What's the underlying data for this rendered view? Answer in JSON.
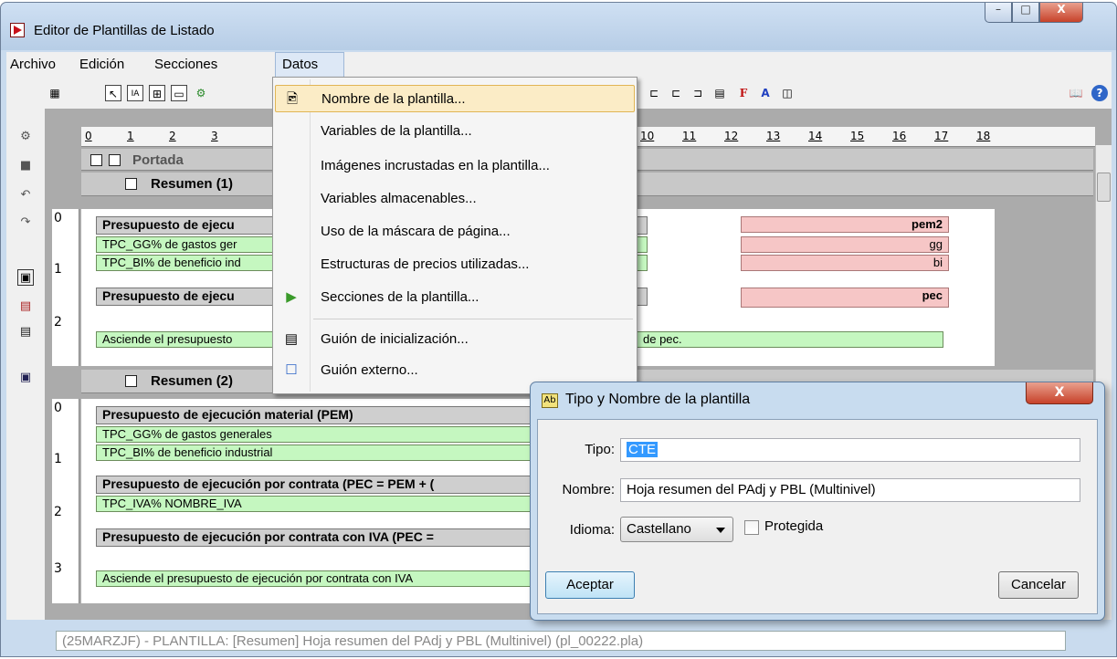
{
  "window": {
    "title": "Editor de Plantillas de Listado",
    "controls": {
      "minimize": "–",
      "maximize": "□",
      "close": "X"
    }
  },
  "menubar": {
    "items": [
      "Archivo",
      "Edición",
      "Secciones",
      "Datos"
    ],
    "active": "Datos"
  },
  "toolbar": {
    "glyphs": [
      "▦",
      "↖",
      "IA",
      "⊞",
      "▭",
      "⚙",
      "⊕",
      "◧"
    ],
    "right_glyphs": [
      "⊏",
      "⊏",
      "⊐",
      "▤",
      "F",
      "A",
      "◫"
    ],
    "far_right": [
      "📖",
      "?"
    ]
  },
  "left_tools": [
    "⚙",
    "■",
    "↶",
    "↷",
    "▣",
    "▤",
    "▤",
    "▣"
  ],
  "ruler": {
    "labels": [
      "0",
      "1",
      "2",
      "3",
      "10",
      "11",
      "12",
      "13",
      "14",
      "15",
      "16",
      "17",
      "18"
    ]
  },
  "editor": {
    "sections": [
      {
        "label": "Portada"
      },
      {
        "label": "Resumen (1)"
      },
      {
        "label": "Resumen (2)"
      }
    ],
    "vruler1_numbers": [
      "0",
      "1",
      "2"
    ],
    "vruler2_numbers": [
      "0",
      "1",
      "2",
      "3"
    ],
    "resumen1": {
      "row_pem_label": "Presupuesto de ejecu",
      "row_gg": "TPC_GG% de gastos ger",
      "row_bi": "TPC_BI% de beneficio ind",
      "row_pec_label": "Presupuesto de ejecu",
      "row_asciende": "Asciende el presupuesto",
      "row_asciende_tail": "de pec.",
      "pink_pem2": "pem2",
      "pink_gg": "gg",
      "pink_bi": "bi",
      "pink_pec": "pec"
    },
    "resumen2": {
      "row_pem": "Presupuesto de ejecución material (PEM)",
      "row_gg": "TPC_GG% de gastos generales",
      "row_bi": "TPC_BI% de beneficio industrial",
      "row_pec": "Presupuesto de ejecución por contrata (PEC = PEM + (",
      "row_iva": "TPC_IVA% NOMBRE_IVA",
      "row_pec_iva": "Presupuesto de ejecución por contrata con IVA (PEC =",
      "row_asciende": "Asciende el presupuesto de ejecución por contrata con IVA"
    }
  },
  "status_line": "(25MARZJF) - PLANTILLA: [Resumen] Hoja resumen del PAdj y PBL (Multinivel) (pl_00222.pla)",
  "datos_menu": {
    "items": [
      {
        "label": "Nombre de la plantilla...",
        "icon": "🖻"
      },
      {
        "label": "Variables de la plantilla...",
        "icon": ""
      },
      {
        "label": "Imágenes incrustadas en la plantilla...",
        "icon": ""
      },
      {
        "label": "Variables almacenables...",
        "icon": ""
      },
      {
        "label": "Uso de la máscara de página...",
        "icon": ""
      },
      {
        "label": "Estructuras de precios utilizadas...",
        "icon": ""
      },
      {
        "label": "Secciones de la plantilla...",
        "icon": "▶"
      },
      {
        "label": "Guión de inicialización...",
        "icon": "▤"
      },
      {
        "label": "Guión externo...",
        "icon": "☐"
      }
    ]
  },
  "dialog": {
    "title": "Tipo y Nombre de la plantilla",
    "icon_glyph": "Ab",
    "close": "X",
    "tipo_label": "Tipo:",
    "tipo_value": "CTE",
    "nombre_label": "Nombre:",
    "nombre_value": "Hoja resumen del PAdj y PBL (Multinivel)",
    "idioma_label": "Idioma:",
    "idioma_value": "Castellano",
    "protegida_label": "Protegida",
    "aceptar": "Aceptar",
    "cancelar": "Cancelar"
  }
}
